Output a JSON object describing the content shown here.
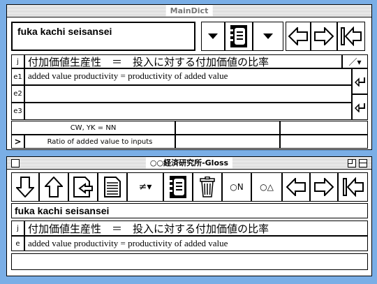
{
  "main_window": {
    "title": "MainDict",
    "query": "fuka kachi seisansei",
    "rows": {
      "j": {
        "label": "j",
        "text": "付加価値生産性　＝　投入に対する付加価値の比率",
        "tool": "／▾"
      },
      "e1": {
        "label": "e1",
        "text": "added value productivity = productivity of added value"
      },
      "e2": {
        "label": "e2",
        "text": ""
      },
      "e3": {
        "label": "e3",
        "text": ""
      }
    },
    "notes": {
      "code": "CW, YK = NN",
      "description": "Ratio of added value to inputs",
      "marker": ">"
    }
  },
  "gloss_window": {
    "title": "○○経済研究所-Gloss",
    "query": "fuka kachi seisansei",
    "toolbar": {
      "neq_label": "≠▾",
      "mark_n": "○N",
      "mark_a": "○△"
    },
    "rows": {
      "j": {
        "label": "j",
        "text": "付加価値生産性　＝　投入に対する付加価値の比率"
      },
      "e": {
        "label": "e",
        "text": "added value productivity = productivity of added value"
      }
    }
  }
}
